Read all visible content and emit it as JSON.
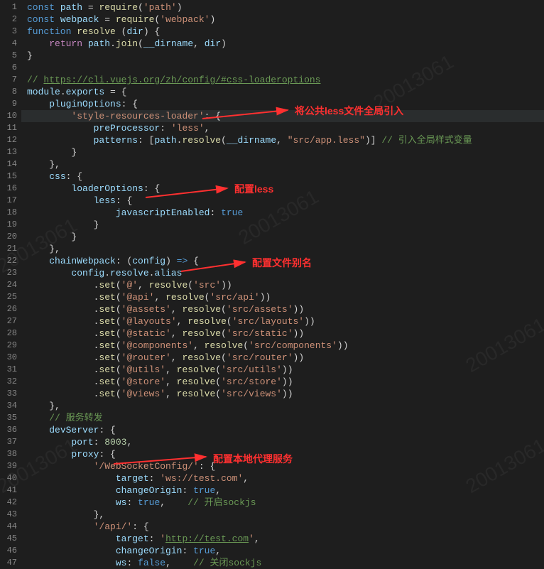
{
  "watermark": "20013061",
  "annotations": {
    "a1": "将公共less文件全局引入",
    "a2": "配置less",
    "a3": "配置文件别名",
    "a4": "配置本地代理服务"
  },
  "lines": [
    {
      "n": "1",
      "seg": [
        {
          "c": "kw",
          "t": "const"
        },
        {
          "c": "pn",
          "t": " "
        },
        {
          "c": "var",
          "t": "path"
        },
        {
          "c": "pn",
          "t": " = "
        },
        {
          "c": "fn",
          "t": "require"
        },
        {
          "c": "pn",
          "t": "("
        },
        {
          "c": "str",
          "t": "'path'"
        },
        {
          "c": "pn",
          "t": ")"
        }
      ]
    },
    {
      "n": "2",
      "seg": [
        {
          "c": "kw",
          "t": "const"
        },
        {
          "c": "pn",
          "t": " "
        },
        {
          "c": "var",
          "t": "webpack"
        },
        {
          "c": "pn",
          "t": " = "
        },
        {
          "c": "fn",
          "t": "require"
        },
        {
          "c": "pn",
          "t": "("
        },
        {
          "c": "str",
          "t": "'webpack'"
        },
        {
          "c": "pn",
          "t": ")"
        }
      ]
    },
    {
      "n": "3",
      "seg": [
        {
          "c": "kw",
          "t": "function"
        },
        {
          "c": "pn",
          "t": " "
        },
        {
          "c": "fn",
          "t": "resolve"
        },
        {
          "c": "pn",
          "t": " ("
        },
        {
          "c": "var",
          "t": "dir"
        },
        {
          "c": "pn",
          "t": ") {"
        }
      ]
    },
    {
      "n": "4",
      "seg": [
        {
          "c": "pn",
          "t": "    "
        },
        {
          "c": "kw2",
          "t": "return"
        },
        {
          "c": "pn",
          "t": " "
        },
        {
          "c": "var",
          "t": "path"
        },
        {
          "c": "pn",
          "t": "."
        },
        {
          "c": "fn",
          "t": "join"
        },
        {
          "c": "pn",
          "t": "("
        },
        {
          "c": "var",
          "t": "__dirname"
        },
        {
          "c": "pn",
          "t": ", "
        },
        {
          "c": "var",
          "t": "dir"
        },
        {
          "c": "pn",
          "t": ")"
        }
      ]
    },
    {
      "n": "5",
      "seg": [
        {
          "c": "pn",
          "t": "}"
        }
      ]
    },
    {
      "n": "6",
      "seg": []
    },
    {
      "n": "7",
      "seg": [
        {
          "c": "comment",
          "t": "// "
        },
        {
          "c": "link",
          "t": "https://cli.vuejs.org/zh/config/#css-loaderoptions"
        }
      ]
    },
    {
      "n": "8",
      "seg": [
        {
          "c": "var",
          "t": "module"
        },
        {
          "c": "pn",
          "t": "."
        },
        {
          "c": "var",
          "t": "exports"
        },
        {
          "c": "pn",
          "t": " = {"
        }
      ]
    },
    {
      "n": "9",
      "seg": [
        {
          "c": "pn",
          "t": "    "
        },
        {
          "c": "prop",
          "t": "pluginOptions"
        },
        {
          "c": "pn",
          "t": ": {"
        }
      ]
    },
    {
      "n": "10",
      "hl": true,
      "seg": [
        {
          "c": "pn",
          "t": "        "
        },
        {
          "c": "str",
          "t": "'style-resources-loader'"
        },
        {
          "c": "pn",
          "t": ": {"
        }
      ]
    },
    {
      "n": "11",
      "seg": [
        {
          "c": "pn",
          "t": "            "
        },
        {
          "c": "prop",
          "t": "preProcessor"
        },
        {
          "c": "pn",
          "t": ": "
        },
        {
          "c": "str",
          "t": "'less'"
        },
        {
          "c": "pn",
          "t": ","
        }
      ]
    },
    {
      "n": "12",
      "seg": [
        {
          "c": "pn",
          "t": "            "
        },
        {
          "c": "prop",
          "t": "patterns"
        },
        {
          "c": "pn",
          "t": ": ["
        },
        {
          "c": "var",
          "t": "path"
        },
        {
          "c": "pn",
          "t": "."
        },
        {
          "c": "fn",
          "t": "resolve"
        },
        {
          "c": "pn",
          "t": "("
        },
        {
          "c": "var",
          "t": "__dirname"
        },
        {
          "c": "pn",
          "t": ", "
        },
        {
          "c": "str",
          "t": "\"src/app.less\""
        },
        {
          "c": "pn",
          "t": ")] "
        },
        {
          "c": "comment",
          "t": "// 引入全局样式变量"
        }
      ]
    },
    {
      "n": "13",
      "seg": [
        {
          "c": "pn",
          "t": "        }"
        }
      ]
    },
    {
      "n": "14",
      "seg": [
        {
          "c": "pn",
          "t": "    },"
        }
      ]
    },
    {
      "n": "15",
      "seg": [
        {
          "c": "pn",
          "t": "    "
        },
        {
          "c": "prop",
          "t": "css"
        },
        {
          "c": "pn",
          "t": ": {"
        }
      ]
    },
    {
      "n": "16",
      "seg": [
        {
          "c": "pn",
          "t": "        "
        },
        {
          "c": "prop",
          "t": "loaderOptions"
        },
        {
          "c": "pn",
          "t": ": {"
        }
      ]
    },
    {
      "n": "17",
      "seg": [
        {
          "c": "pn",
          "t": "            "
        },
        {
          "c": "prop",
          "t": "less"
        },
        {
          "c": "pn",
          "t": ": {"
        }
      ]
    },
    {
      "n": "18",
      "seg": [
        {
          "c": "pn",
          "t": "                "
        },
        {
          "c": "prop",
          "t": "javascriptEnabled"
        },
        {
          "c": "pn",
          "t": ": "
        },
        {
          "c": "bool",
          "t": "true"
        }
      ]
    },
    {
      "n": "19",
      "seg": [
        {
          "c": "pn",
          "t": "            }"
        }
      ]
    },
    {
      "n": "20",
      "seg": [
        {
          "c": "pn",
          "t": "        }"
        }
      ]
    },
    {
      "n": "21",
      "seg": [
        {
          "c": "pn",
          "t": "    },"
        }
      ]
    },
    {
      "n": "22",
      "seg": [
        {
          "c": "pn",
          "t": "    "
        },
        {
          "c": "prop",
          "t": "chainWebpack"
        },
        {
          "c": "pn",
          "t": ": ("
        },
        {
          "c": "var",
          "t": "config"
        },
        {
          "c": "pn",
          "t": ") "
        },
        {
          "c": "kw",
          "t": "=>"
        },
        {
          "c": "pn",
          "t": " {"
        }
      ]
    },
    {
      "n": "23",
      "seg": [
        {
          "c": "pn",
          "t": "        "
        },
        {
          "c": "var",
          "t": "config"
        },
        {
          "c": "pn",
          "t": "."
        },
        {
          "c": "var",
          "t": "resolve"
        },
        {
          "c": "pn",
          "t": "."
        },
        {
          "c": "var",
          "t": "alias"
        }
      ]
    },
    {
      "n": "24",
      "seg": [
        {
          "c": "pn",
          "t": "            ."
        },
        {
          "c": "fn",
          "t": "set"
        },
        {
          "c": "pn",
          "t": "("
        },
        {
          "c": "str",
          "t": "'@'"
        },
        {
          "c": "pn",
          "t": ", "
        },
        {
          "c": "fn",
          "t": "resolve"
        },
        {
          "c": "pn",
          "t": "("
        },
        {
          "c": "str",
          "t": "'src'"
        },
        {
          "c": "pn",
          "t": "))"
        }
      ]
    },
    {
      "n": "25",
      "seg": [
        {
          "c": "pn",
          "t": "            ."
        },
        {
          "c": "fn",
          "t": "set"
        },
        {
          "c": "pn",
          "t": "("
        },
        {
          "c": "str",
          "t": "'@api'"
        },
        {
          "c": "pn",
          "t": ", "
        },
        {
          "c": "fn",
          "t": "resolve"
        },
        {
          "c": "pn",
          "t": "("
        },
        {
          "c": "str",
          "t": "'src/api'"
        },
        {
          "c": "pn",
          "t": "))"
        }
      ]
    },
    {
      "n": "26",
      "seg": [
        {
          "c": "pn",
          "t": "            ."
        },
        {
          "c": "fn",
          "t": "set"
        },
        {
          "c": "pn",
          "t": "("
        },
        {
          "c": "str",
          "t": "'@assets'"
        },
        {
          "c": "pn",
          "t": ", "
        },
        {
          "c": "fn",
          "t": "resolve"
        },
        {
          "c": "pn",
          "t": "("
        },
        {
          "c": "str",
          "t": "'src/assets'"
        },
        {
          "c": "pn",
          "t": "))"
        }
      ]
    },
    {
      "n": "27",
      "seg": [
        {
          "c": "pn",
          "t": "            ."
        },
        {
          "c": "fn",
          "t": "set"
        },
        {
          "c": "pn",
          "t": "("
        },
        {
          "c": "str",
          "t": "'@layouts'"
        },
        {
          "c": "pn",
          "t": ", "
        },
        {
          "c": "fn",
          "t": "resolve"
        },
        {
          "c": "pn",
          "t": "("
        },
        {
          "c": "str",
          "t": "'src/layouts'"
        },
        {
          "c": "pn",
          "t": "))"
        }
      ]
    },
    {
      "n": "28",
      "seg": [
        {
          "c": "pn",
          "t": "            ."
        },
        {
          "c": "fn",
          "t": "set"
        },
        {
          "c": "pn",
          "t": "("
        },
        {
          "c": "str",
          "t": "'@static'"
        },
        {
          "c": "pn",
          "t": ", "
        },
        {
          "c": "fn",
          "t": "resolve"
        },
        {
          "c": "pn",
          "t": "("
        },
        {
          "c": "str",
          "t": "'src/static'"
        },
        {
          "c": "pn",
          "t": "))"
        }
      ]
    },
    {
      "n": "29",
      "seg": [
        {
          "c": "pn",
          "t": "            ."
        },
        {
          "c": "fn",
          "t": "set"
        },
        {
          "c": "pn",
          "t": "("
        },
        {
          "c": "str",
          "t": "'@components'"
        },
        {
          "c": "pn",
          "t": ", "
        },
        {
          "c": "fn",
          "t": "resolve"
        },
        {
          "c": "pn",
          "t": "("
        },
        {
          "c": "str",
          "t": "'src/components'"
        },
        {
          "c": "pn",
          "t": "))"
        }
      ]
    },
    {
      "n": "30",
      "seg": [
        {
          "c": "pn",
          "t": "            ."
        },
        {
          "c": "fn",
          "t": "set"
        },
        {
          "c": "pn",
          "t": "("
        },
        {
          "c": "str",
          "t": "'@router'"
        },
        {
          "c": "pn",
          "t": ", "
        },
        {
          "c": "fn",
          "t": "resolve"
        },
        {
          "c": "pn",
          "t": "("
        },
        {
          "c": "str",
          "t": "'src/router'"
        },
        {
          "c": "pn",
          "t": "))"
        }
      ]
    },
    {
      "n": "31",
      "seg": [
        {
          "c": "pn",
          "t": "            ."
        },
        {
          "c": "fn",
          "t": "set"
        },
        {
          "c": "pn",
          "t": "("
        },
        {
          "c": "str",
          "t": "'@utils'"
        },
        {
          "c": "pn",
          "t": ", "
        },
        {
          "c": "fn",
          "t": "resolve"
        },
        {
          "c": "pn",
          "t": "("
        },
        {
          "c": "str",
          "t": "'src/utils'"
        },
        {
          "c": "pn",
          "t": "))"
        }
      ]
    },
    {
      "n": "32",
      "seg": [
        {
          "c": "pn",
          "t": "            ."
        },
        {
          "c": "fn",
          "t": "set"
        },
        {
          "c": "pn",
          "t": "("
        },
        {
          "c": "str",
          "t": "'@store'"
        },
        {
          "c": "pn",
          "t": ", "
        },
        {
          "c": "fn",
          "t": "resolve"
        },
        {
          "c": "pn",
          "t": "("
        },
        {
          "c": "str",
          "t": "'src/store'"
        },
        {
          "c": "pn",
          "t": "))"
        }
      ]
    },
    {
      "n": "33",
      "seg": [
        {
          "c": "pn",
          "t": "            ."
        },
        {
          "c": "fn",
          "t": "set"
        },
        {
          "c": "pn",
          "t": "("
        },
        {
          "c": "str",
          "t": "'@views'"
        },
        {
          "c": "pn",
          "t": ", "
        },
        {
          "c": "fn",
          "t": "resolve"
        },
        {
          "c": "pn",
          "t": "("
        },
        {
          "c": "str",
          "t": "'src/views'"
        },
        {
          "c": "pn",
          "t": "))"
        }
      ]
    },
    {
      "n": "34",
      "seg": [
        {
          "c": "pn",
          "t": "    },"
        }
      ]
    },
    {
      "n": "35",
      "seg": [
        {
          "c": "pn",
          "t": "    "
        },
        {
          "c": "comment",
          "t": "// 服务转发"
        }
      ]
    },
    {
      "n": "36",
      "seg": [
        {
          "c": "pn",
          "t": "    "
        },
        {
          "c": "prop",
          "t": "devServer"
        },
        {
          "c": "pn",
          "t": ": {"
        }
      ]
    },
    {
      "n": "37",
      "seg": [
        {
          "c": "pn",
          "t": "        "
        },
        {
          "c": "prop",
          "t": "port"
        },
        {
          "c": "pn",
          "t": ": "
        },
        {
          "c": "num",
          "t": "8003"
        },
        {
          "c": "pn",
          "t": ","
        }
      ]
    },
    {
      "n": "38",
      "seg": [
        {
          "c": "pn",
          "t": "        "
        },
        {
          "c": "prop",
          "t": "proxy"
        },
        {
          "c": "pn",
          "t": ": {"
        }
      ]
    },
    {
      "n": "39",
      "seg": [
        {
          "c": "pn",
          "t": "            "
        },
        {
          "c": "str",
          "t": "'/WebSocketConfig/'"
        },
        {
          "c": "pn",
          "t": ": {"
        }
      ]
    },
    {
      "n": "40",
      "seg": [
        {
          "c": "pn",
          "t": "                "
        },
        {
          "c": "prop",
          "t": "target"
        },
        {
          "c": "pn",
          "t": ": "
        },
        {
          "c": "str",
          "t": "'ws://test.com'"
        },
        {
          "c": "pn",
          "t": ","
        }
      ]
    },
    {
      "n": "41",
      "seg": [
        {
          "c": "pn",
          "t": "                "
        },
        {
          "c": "prop",
          "t": "changeOrigin"
        },
        {
          "c": "pn",
          "t": ": "
        },
        {
          "c": "bool",
          "t": "true"
        },
        {
          "c": "pn",
          "t": ","
        }
      ]
    },
    {
      "n": "42",
      "seg": [
        {
          "c": "pn",
          "t": "                "
        },
        {
          "c": "prop",
          "t": "ws"
        },
        {
          "c": "pn",
          "t": ": "
        },
        {
          "c": "bool",
          "t": "true"
        },
        {
          "c": "pn",
          "t": ",    "
        },
        {
          "c": "comment",
          "t": "// 开启sockjs"
        }
      ]
    },
    {
      "n": "43",
      "seg": [
        {
          "c": "pn",
          "t": "            },"
        }
      ]
    },
    {
      "n": "44",
      "seg": [
        {
          "c": "pn",
          "t": "            "
        },
        {
          "c": "str",
          "t": "'/api/'"
        },
        {
          "c": "pn",
          "t": ": {"
        }
      ]
    },
    {
      "n": "45",
      "seg": [
        {
          "c": "pn",
          "t": "                "
        },
        {
          "c": "prop",
          "t": "target"
        },
        {
          "c": "pn",
          "t": ": "
        },
        {
          "c": "str",
          "t": "'"
        },
        {
          "c": "link",
          "t": "http://test.com"
        },
        {
          "c": "str",
          "t": "'"
        },
        {
          "c": "pn",
          "t": ","
        }
      ]
    },
    {
      "n": "46",
      "seg": [
        {
          "c": "pn",
          "t": "                "
        },
        {
          "c": "prop",
          "t": "changeOrigin"
        },
        {
          "c": "pn",
          "t": ": "
        },
        {
          "c": "bool",
          "t": "true"
        },
        {
          "c": "pn",
          "t": ","
        }
      ]
    },
    {
      "n": "47",
      "seg": [
        {
          "c": "pn",
          "t": "                "
        },
        {
          "c": "prop",
          "t": "ws"
        },
        {
          "c": "pn",
          "t": ": "
        },
        {
          "c": "bool",
          "t": "false"
        },
        {
          "c": "pn",
          "t": ",    "
        },
        {
          "c": "comment",
          "t": "// 关闭sockjs"
        }
      ]
    }
  ]
}
